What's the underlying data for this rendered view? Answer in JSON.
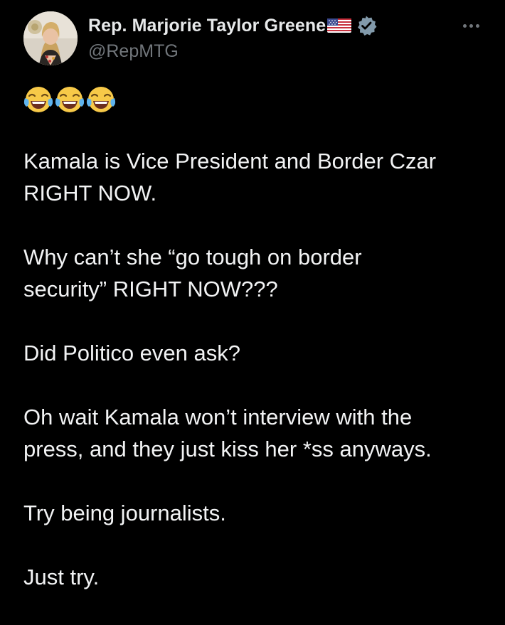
{
  "author": {
    "display_name": "Rep. Marjorie Taylor Greene",
    "handle": "@RepMTG",
    "avatar_icon": "profile-photo",
    "flag_icon": "us-flag-emoji",
    "verified_icon": "gray-verified-badge",
    "verified_color": "#829aab"
  },
  "more_icon": "more-options-icon",
  "emojis": [
    "face-with-tears-of-joy",
    "face-with-tears-of-joy",
    "face-with-tears-of-joy"
  ],
  "body": {
    "paragraphs": [
      "Kamala is Vice President and Border Czar\nRIGHT NOW.",
      "Why can’t she “go tough on border\nsecurity” RIGHT NOW???",
      "Did Politico even ask?",
      "Oh wait Kamala won’t interview with the\npress, and they just kiss her *ss anyways.",
      "Try being journalists.",
      "Just try."
    ]
  },
  "colors": {
    "background": "#000000",
    "text": "#e7e9ea",
    "secondary": "#71767b"
  }
}
